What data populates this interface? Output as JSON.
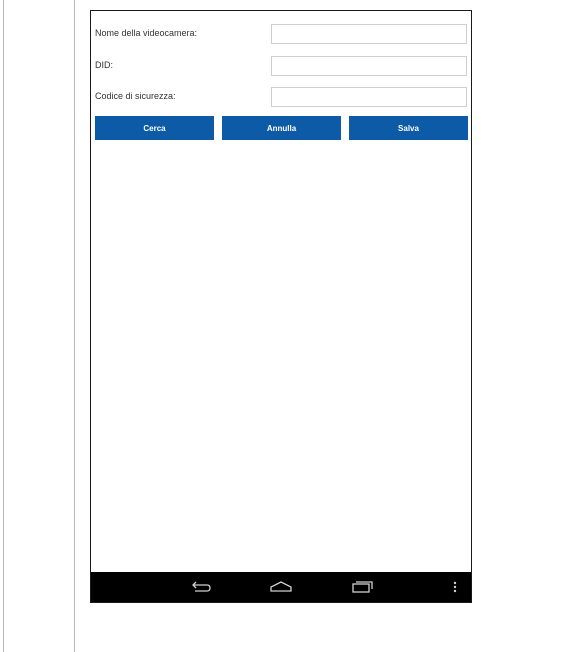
{
  "form": {
    "fields": [
      {
        "label": "Nome della videocamera:",
        "value": "",
        "placeholder": ""
      },
      {
        "label": "DID:",
        "value": "",
        "placeholder": ""
      },
      {
        "label": "Codice di sicurezza:",
        "value": "",
        "placeholder": ""
      }
    ]
  },
  "buttons": {
    "search_label": "Cerca",
    "cancel_label": "Annulla",
    "save_label": "Salva"
  },
  "navbar": {
    "icons": [
      "back-icon",
      "home-icon",
      "recent-apps-icon",
      "overflow-menu-icon"
    ]
  },
  "colors": {
    "button_background": "#0d5aa6",
    "button_text": "#ffffff",
    "navbar_background": "#000000"
  }
}
